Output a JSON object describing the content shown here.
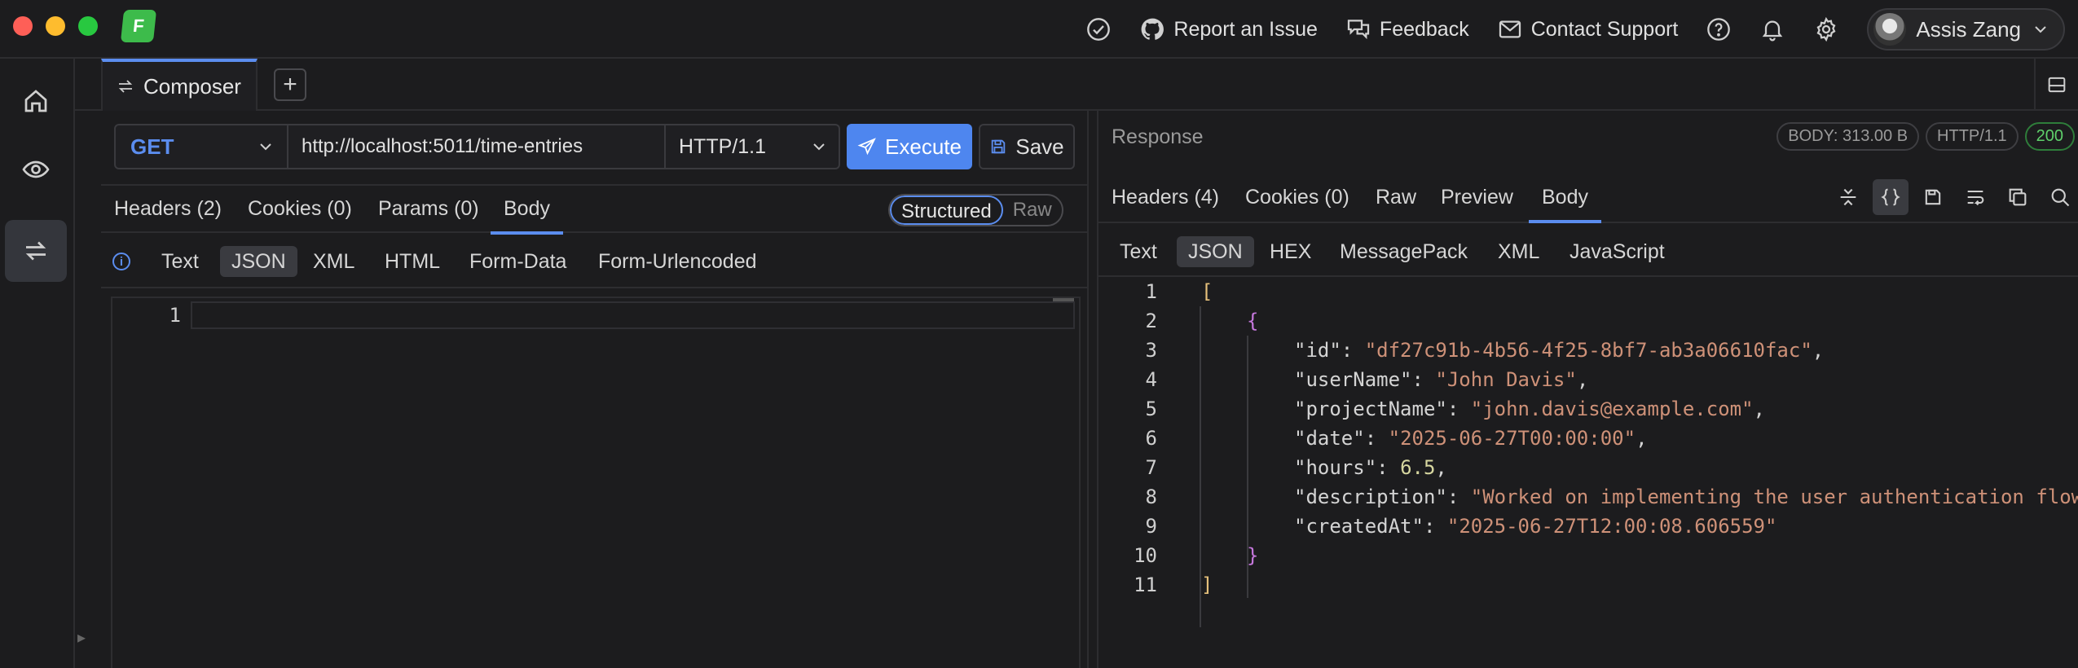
{
  "titlebar": {
    "logo_letter": "F",
    "report_issue": "Report an Issue",
    "feedback": "Feedback",
    "contact_support": "Contact Support",
    "user_name": "Assis Zang"
  },
  "tabs": {
    "composer": "Composer",
    "add": "+"
  },
  "request": {
    "method": "GET",
    "url": "http://localhost:5011/time-entries",
    "protocol": "HTTP/1.1",
    "execute": "Execute",
    "save": "Save",
    "tabs": {
      "headers": "Headers (2)",
      "cookies": "Cookies (0)",
      "params": "Params (0)",
      "body": "Body"
    },
    "mode": {
      "structured": "Structured",
      "raw": "Raw"
    },
    "body_types": [
      "Text",
      "JSON",
      "XML",
      "HTML",
      "Form-Data",
      "Form-Urlencoded"
    ],
    "selected_body_type": "JSON",
    "editor_line_1": "1"
  },
  "response": {
    "title": "Response",
    "body_size": "BODY: 313.00 B",
    "protocol": "HTTP/1.1",
    "status": "200",
    "tabs": {
      "headers": "Headers (4)",
      "cookies": "Cookies (0)",
      "raw": "Raw",
      "preview": "Preview",
      "body": "Body"
    },
    "types": [
      "Text",
      "JSON",
      "HEX",
      "MessagePack",
      "XML",
      "JavaScript"
    ],
    "selected_type": "JSON",
    "json": {
      "id": "df27c91b-4b56-4f25-8bf7-ab3a06610fac",
      "userName": "John Davis",
      "projectName": "john.davis@example.com",
      "date": "2025-06-27T00:00:00",
      "hours": "6.5",
      "description": "Worked on implementing the user authentication flow",
      "createdAt": "2025-06-27T12:00:08.606559"
    }
  },
  "colors": {
    "accent": "#5b8def",
    "execute": "#4e86ef",
    "status_ok": "#5fd06b",
    "string": "#ce9178"
  }
}
